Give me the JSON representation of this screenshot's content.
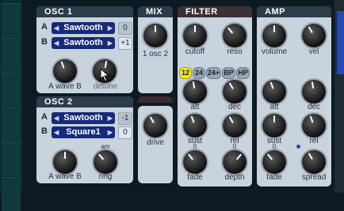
{
  "osc1": {
    "title": "OSC 1",
    "row_a": {
      "label": "A",
      "wave": "Sawtooth",
      "value": "0"
    },
    "row_b": {
      "label": "B",
      "wave": "Sawtooth",
      "value": "+1"
    },
    "knob_labels": {
      "wave": "A wave B",
      "detune": "detune"
    }
  },
  "osc2": {
    "title": "OSC 2",
    "row_a": {
      "label": "A",
      "wave": "Sawtooth",
      "value": "-1"
    },
    "row_b": {
      "label": "B",
      "wave": "Square1",
      "value": "0"
    },
    "knob_labels": {
      "wave": "A wave B",
      "ring": "ring",
      "am": "am"
    }
  },
  "mix": {
    "title": "MIX",
    "knob_label": "1 osc 2",
    "drive_label": "drive"
  },
  "filter": {
    "title": "FILTER",
    "labels": {
      "cutoff": "cutoff",
      "reso": "reso",
      "att": "att",
      "dec": "dec",
      "sust": "sust",
      "rel": "rel",
      "fade": "fade",
      "depth": "depth"
    },
    "modes": [
      "12",
      "24",
      "24+",
      "BP",
      "HP"
    ],
    "active_mode": "12",
    "fade_top": "0",
    "depth_top": "0"
  },
  "amp": {
    "title": "AMP",
    "labels": {
      "volume": "volume",
      "vel": "vel",
      "att": "att",
      "dec": "dec",
      "sust": "sust",
      "rel": "rel",
      "fade": "fade",
      "spread": "spread"
    },
    "fade_top": "0"
  },
  "colors": {
    "panel": "#c9d3de",
    "header": "#2c3c4a",
    "selector": "#152a7a",
    "active_mode": "#f1ea1c"
  }
}
